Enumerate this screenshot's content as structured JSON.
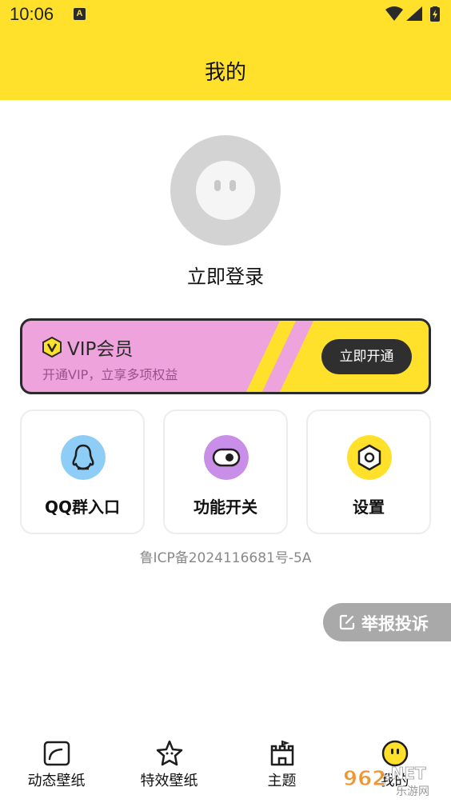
{
  "status_bar": {
    "time": "10:06",
    "notification_badge": "A"
  },
  "header": {
    "title": "我的"
  },
  "profile": {
    "login_label": "立即登录"
  },
  "vip": {
    "title": "VIP会员",
    "subtitle": "开通VIP，立享多项权益",
    "button": "立即开通",
    "colors": {
      "card": "#efa3dc",
      "stripe": "#ffe02a",
      "button": "#2f2f2f"
    }
  },
  "tiles": [
    {
      "label": "QQ群入口",
      "icon": "qq-penguin-icon",
      "color": "#8ecdf6"
    },
    {
      "label": "功能开关",
      "icon": "toggle-switch-icon",
      "color": "#c98ee8"
    },
    {
      "label": "设置",
      "icon": "hex-nut-settings-icon",
      "color": "#ffe02a"
    }
  ],
  "icp_text": "鲁ICP备2024116681号-5A",
  "report": {
    "label": "举报投诉",
    "icon": "edit-note-icon"
  },
  "tabbar": {
    "items": [
      {
        "label": "动态壁纸",
        "icon": "wallpaper-icon"
      },
      {
        "label": "特效壁纸",
        "icon": "star-face-icon"
      },
      {
        "label": "主题",
        "icon": "castle-icon"
      },
      {
        "label": "我的",
        "icon": "smiley-face-icon",
        "active": true
      }
    ]
  },
  "watermark": {
    "line1": "962.NET",
    "line2": "乐游网"
  }
}
